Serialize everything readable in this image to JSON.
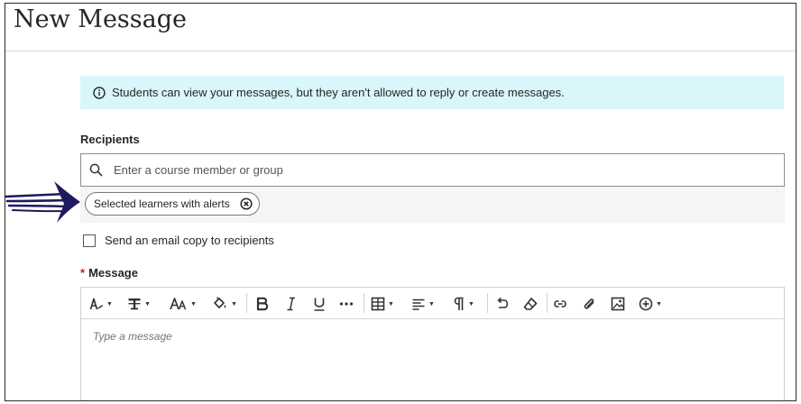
{
  "page": {
    "title": "New Message"
  },
  "info_banner": {
    "text": "Students can view your messages, but they aren't allowed to reply or create messages."
  },
  "recipients": {
    "label": "Recipients",
    "search_placeholder": "Enter a course member or group",
    "selected": [
      {
        "label": "Selected learners with alerts"
      }
    ]
  },
  "email_copy": {
    "label": "Send an email copy to recipients",
    "checked": false
  },
  "message": {
    "required_marker": "*",
    "label": "Message",
    "placeholder": "Type a message",
    "toolbar": [
      "paragraph-style",
      "text-style",
      "font-size",
      "text-color",
      "bold",
      "italic",
      "underline",
      "more",
      "table",
      "alignment",
      "paragraph-format",
      "undo",
      "clear-formatting",
      "insert-link",
      "attach-file",
      "insert-image",
      "insert-content"
    ]
  },
  "annotation": {
    "arrow_color": "#1e1a5e"
  }
}
